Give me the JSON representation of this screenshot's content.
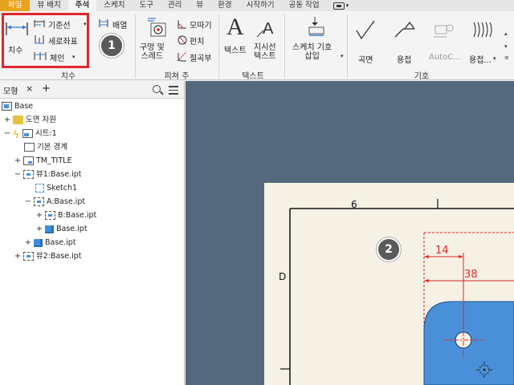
{
  "tabs": [
    "파일",
    "뷰 배치",
    "주석",
    "스케치",
    "도구",
    "관리",
    "뷰",
    "환경",
    "시작하기",
    "공동 작업"
  ],
  "active_tab": "주석",
  "ribbon": {
    "dimension_panel": {
      "label": "치수",
      "dimension_button": "치수",
      "baseline_button": "기준선",
      "ordinate_button": "세로좌표",
      "chain_button": "체인",
      "arrange_button": "배열"
    },
    "feature_notes_panel": {
      "label": "피쳐 주",
      "hole_thread_button": "구멍 및\n스레드",
      "chamfer_button": "모따기",
      "punch_button": "펀치",
      "bend_button": "절곡부"
    },
    "text_panel": {
      "label": "텍스트",
      "text_button": "텍스트",
      "leader_text_button": "지시선\n텍스트"
    },
    "sketch_symbol_button": "스케치 기호\n삽입",
    "symbols_panel": {
      "label": "기호",
      "surface_button": "곡면",
      "weld_button": "용접",
      "autocenter_button": "AutoC...",
      "weld_bead_button": "용접..."
    }
  },
  "badges": [
    "1",
    "2"
  ],
  "browser": {
    "tab_label": "모형",
    "close_symbol": "×",
    "add_symbol": "+",
    "tree": [
      {
        "label": "Base",
        "level": 0,
        "expander": "",
        "icon": "base-icon"
      },
      {
        "label": "도면 자원",
        "level": 0,
        "expander": "+",
        "icon": "folder-icon"
      },
      {
        "label": "시트:1",
        "level": 0,
        "expander": "−",
        "icon": "sheet-icon"
      },
      {
        "label": "기본 경계",
        "level": 1,
        "expander": "",
        "icon": "frame-icon"
      },
      {
        "label": "TM_TITLE",
        "level": 1,
        "expander": "+",
        "icon": "title-block-icon"
      },
      {
        "label": "뷰1:Base.ipt",
        "level": 1,
        "expander": "−",
        "icon": "view-icon"
      },
      {
        "label": "Sketch1",
        "level": 2,
        "expander": "",
        "icon": "sketch-icon"
      },
      {
        "label": "A:Base.ipt",
        "level": 2,
        "expander": "−",
        "icon": "view-icon"
      },
      {
        "label": "B:Base.ipt",
        "level": 3,
        "expander": "+",
        "icon": "section-view-icon"
      },
      {
        "label": "Base.ipt",
        "level": 3,
        "expander": "+",
        "icon": "part-icon"
      },
      {
        "label": "Base.ipt",
        "level": 2,
        "expander": "+",
        "icon": "part-icon"
      },
      {
        "label": "뷰2:Base.ipt",
        "level": 1,
        "expander": "+",
        "icon": "view-icon"
      }
    ]
  },
  "drawing": {
    "zone_number": "6",
    "zone_letter": "D",
    "dim_small": "14",
    "dim_large": "38"
  },
  "colors": {
    "file_tab": "#e8a21e",
    "highlight": "#e0262c",
    "canvas_bg": "#56687c",
    "paper": "#f5f1e4",
    "dimension": "#e0262c",
    "part_fill": "#4a90d9"
  }
}
